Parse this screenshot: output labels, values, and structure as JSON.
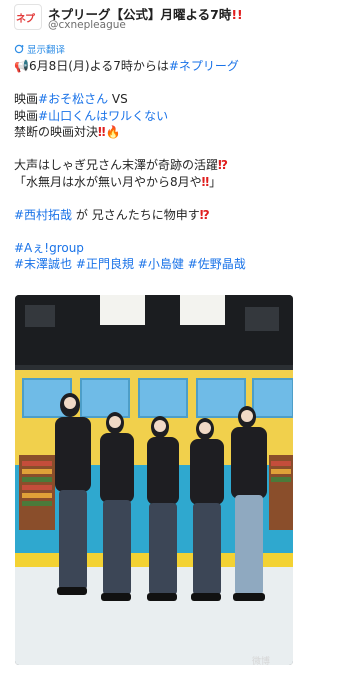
{
  "account": {
    "name": "ネプリーグ【公式】月曜よる7時",
    "name_badge": "!!",
    "handle": "@cxnepleague",
    "avatar_logo": "ネプ"
  },
  "translate_label": "显示翻译",
  "post": {
    "line1_prefix": "6月8日(月)よる7時からは",
    "line1_tag": "#ネプリーグ",
    "line2_prefix": "映画",
    "line2_tag": "#おそ松さん",
    "line2_suffix": "VS",
    "line3_prefix": "映画",
    "line3_tag": "#山口くんはワルくない",
    "line4": "禁断の映画対決",
    "line5": "大声はしゃぎ兄さん末澤が奇跡の活躍",
    "line6": "「水無月は水が無い月やから8月や",
    "line6_end": "」",
    "line7_tag": "#西村拓哉",
    "line7_suffix": "が 兄さんたちに物申す",
    "line8_tag": "#Aぇ!group",
    "line9_tags": [
      "#末澤誠也",
      "#正門良規",
      "#小島健",
      "#佐野晶哉"
    ]
  },
  "watermark": "微博"
}
